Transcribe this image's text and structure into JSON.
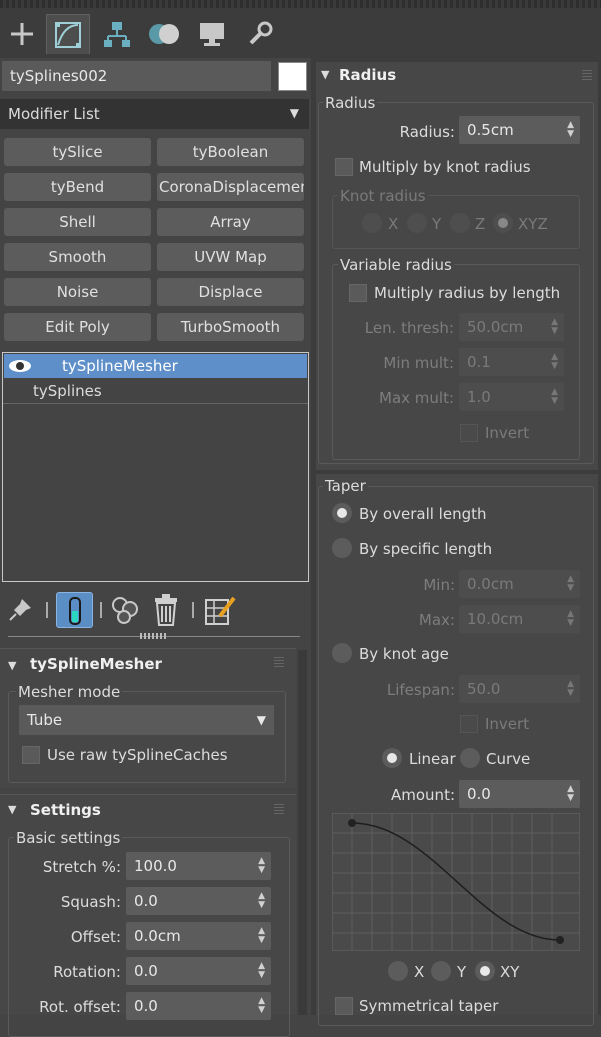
{
  "object_name": "tySplines002",
  "modifier_list": "Modifier List",
  "modifier_buttons": [
    "tySlice",
    "tyBoolean",
    "tyBend",
    "CoronaDisplacementMod",
    "Shell",
    "Array",
    "Smooth",
    "UVW Map",
    "Noise",
    "Displace",
    "Edit Poly",
    "TurboSmooth"
  ],
  "stack": {
    "items": [
      "tySplineMesher",
      "tySplines"
    ]
  },
  "mesher": {
    "title": "tySplineMesher",
    "mesher_mode_label": "Mesher mode",
    "mesher_mode_value": "Tube",
    "use_raw_label": "Use raw tySplineCaches"
  },
  "settings": {
    "title": "Settings",
    "basic_label": "Basic settings",
    "stretch_label": "Stretch %:",
    "stretch_value": "100.0",
    "squash_label": "Squash:",
    "squash_value": "0.0",
    "offset_label": "Offset:",
    "offset_value": "0.0cm",
    "rotation_label": "Rotation:",
    "rotation_value": "0.0",
    "rot_offset_label": "Rot. offset:",
    "rot_offset_value": "0.0"
  },
  "radius": {
    "title": "Radius",
    "group_label": "Radius",
    "radius_label": "Radius:",
    "radius_value": "0.5cm",
    "multiply_knot_label": "Multiply by knot radius",
    "knot_radius_label": "Knot radius",
    "knot_axes": [
      "X",
      "Y",
      "Z",
      "XYZ"
    ],
    "variable_label": "Variable radius",
    "multiply_length_label": "Multiply radius by length",
    "len_thresh_label": "Len. thresh:",
    "len_thresh_value": "50.0cm",
    "min_mult_label": "Min mult:",
    "min_mult_value": "0.1",
    "max_mult_label": "Max mult:",
    "max_mult_value": "1.0",
    "invert_label": "Invert"
  },
  "taper": {
    "group_label": "Taper",
    "by_overall_label": "By overall length",
    "by_specific_label": "By specific length",
    "min_label": "Min:",
    "min_value": "0.0cm",
    "max_label": "Max:",
    "max_value": "10.0cm",
    "by_knot_age_label": "By knot age",
    "lifespan_label": "Lifespan:",
    "lifespan_value": "50.0",
    "invert_label": "Invert",
    "linear_label": "Linear",
    "curve_label": "Curve",
    "amount_label": "Amount:",
    "amount_value": "0.0",
    "axes": [
      "X",
      "Y",
      "XY"
    ],
    "symmetrical_label": "Symmetrical taper"
  }
}
